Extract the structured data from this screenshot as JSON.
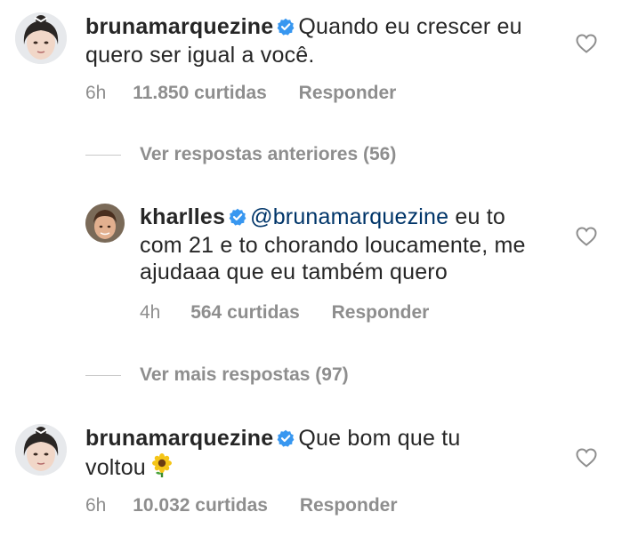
{
  "comments": [
    {
      "username": "brunamarquezine",
      "verified": true,
      "text": "Quando eu crescer eu quero ser igual a você.",
      "time": "6h",
      "likes": "11.850 curtidas",
      "reply_label": "Responder"
    },
    {
      "username": "kharlles",
      "verified": true,
      "mention": "@brunamarquezine",
      "text": " eu to com 21 e to chorando loucamente, me ajudaaa que eu também quero",
      "time": "4h",
      "likes": "564 curtidas",
      "reply_label": "Responder"
    },
    {
      "username": "brunamarquezine",
      "verified": true,
      "text": "Que bom que tu voltou",
      "emoji": "sunflower-emoji",
      "time": "6h",
      "likes": "10.032 curtidas",
      "reply_label": "Responder"
    }
  ],
  "toggles": {
    "previous_replies": "Ver respostas anteriores (56)",
    "more_replies": "Ver mais respostas (97)"
  },
  "colors": {
    "text": "#262626",
    "secondary": "#8e8e8e",
    "mention": "#003569",
    "verified": "#3897f0"
  }
}
